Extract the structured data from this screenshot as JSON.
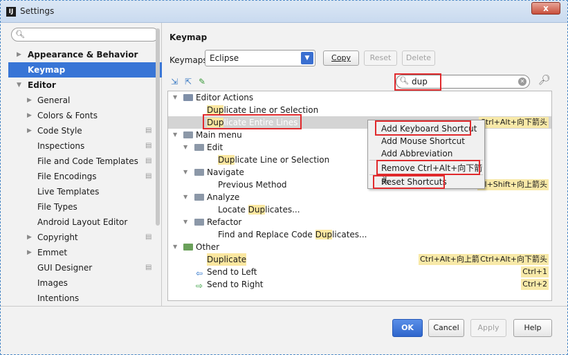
{
  "window": {
    "title": "Settings",
    "close_glyph": "x"
  },
  "sidebar": {
    "search_placeholder": "",
    "items": [
      {
        "label": "Appearance & Behavior",
        "arrow": "▶"
      },
      {
        "label": "Keymap"
      },
      {
        "label": "Editor",
        "arrow": "▼"
      },
      {
        "label": "General",
        "arrow": "▶"
      },
      {
        "label": "Colors & Fonts",
        "arrow": "▶"
      },
      {
        "label": "Code Style",
        "arrow": "▶"
      },
      {
        "label": "Inspections"
      },
      {
        "label": "File and Code Templates"
      },
      {
        "label": "File Encodings"
      },
      {
        "label": "Live Templates"
      },
      {
        "label": "File Types"
      },
      {
        "label": "Android Layout Editor"
      },
      {
        "label": "Copyright",
        "arrow": "▶"
      },
      {
        "label": "Emmet",
        "arrow": "▶"
      },
      {
        "label": "GUI Designer"
      },
      {
        "label": "Images"
      },
      {
        "label": "Intentions"
      }
    ]
  },
  "keymap": {
    "title": "Keymap",
    "keymaps_label": "Keymaps:",
    "selected_keymap": "Eclipse",
    "copy_label": "Copy",
    "reset_label": "Reset",
    "delete_label": "Delete",
    "search_value": "dup"
  },
  "tree": {
    "editor_actions": "Editor Actions",
    "r1_hl": "Dup",
    "r1_rest": "licate Line or Selection",
    "r2_hl": "Dup",
    "r2_rest": "licate Entire Lines",
    "r2_shortcut": "Ctrl+Alt+向下箭头",
    "main_menu": "Main menu",
    "edit": "Edit",
    "r3_hl": "Dup",
    "r3_rest": "licate Line or Selection",
    "navigate": "Navigate",
    "previous_method": "Previous Method",
    "prev_shortcut": "trl+Shift+向上箭头",
    "analyze": "Analyze",
    "locate_pre": "Locate ",
    "locate_hl": "Dup",
    "locate_rest": "licates...",
    "refactor": "Refactor",
    "find_pre": "Find and Replace Code ",
    "find_hl": "Dup",
    "find_rest": "licates...",
    "other": "Other",
    "duplicate": "Duplicate",
    "dup_sc1": "Ctrl+Alt+向上箭头",
    "dup_sc2": "Ctrl+Alt+向下箭头",
    "send_left": "Send to Left",
    "send_left_sc": "Ctrl+1",
    "send_right": "Send to Right",
    "send_right_sc": "Ctrl+2"
  },
  "context_menu": {
    "add_keyboard": "Add Keyboard Shortcut",
    "add_mouse": "Add Mouse Shortcut",
    "add_abbrev": "Add Abbreviation",
    "remove": "Remove Ctrl+Alt+向下箭头",
    "reset": "Reset Shortcuts"
  },
  "footer": {
    "ok": "OK",
    "cancel": "Cancel",
    "apply": "Apply",
    "help": "Help"
  }
}
